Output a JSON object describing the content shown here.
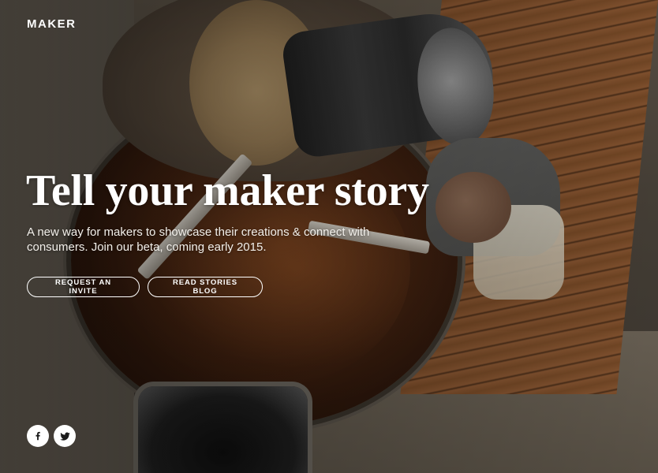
{
  "brand": "MAKER",
  "hero": {
    "headline": "Tell your maker story",
    "subtext": "A new way for makers to showcase their creations & connect with consumers. Join our beta, coming early 2015."
  },
  "buttons": {
    "invite_label": "REQUEST AN INVITE",
    "blog_label": "READ STORIES BLOG"
  },
  "social": [
    {
      "icon": "facebook-icon"
    },
    {
      "icon": "twitter-icon"
    }
  ],
  "colors": {
    "text": "#ffffff",
    "button_border": "#ffffff",
    "social_bg": "#ffffff",
    "social_icon": "#1a1a1a"
  }
}
